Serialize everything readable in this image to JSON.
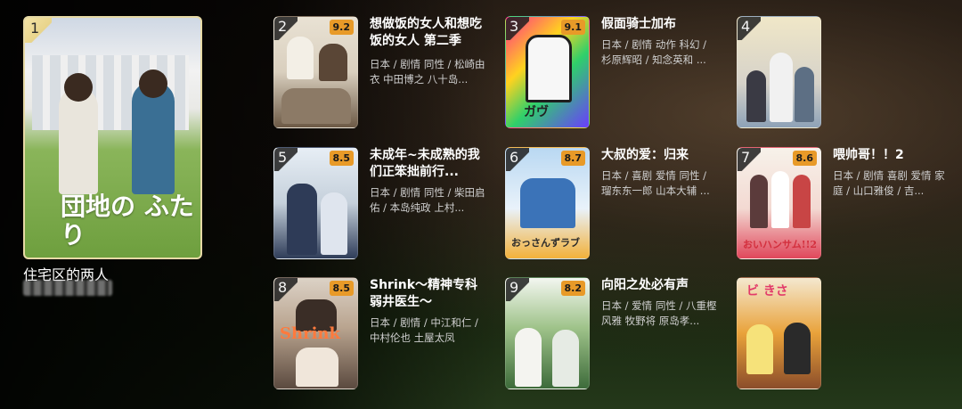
{
  "featured": {
    "rank": "1",
    "title": "住宅区的两人",
    "poster_title": "団地の ふたり"
  },
  "items": [
    {
      "rank": "2",
      "score": "9.2",
      "title": "想做饭的女人和想吃饭的女人 第二季",
      "meta": "日本 / 剧情 同性 / 松崎由衣 中田博之 八十岛..."
    },
    {
      "rank": "3",
      "score": "9.1",
      "title": "假面骑士加布",
      "meta": "日本 / 剧情 动作 科幻 / 杉原辉昭 / 知念英和 ..."
    },
    {
      "rank": "4",
      "score": "",
      "title": "",
      "meta": ""
    },
    {
      "rank": "5",
      "score": "8.5",
      "title": "未成年~未成熟的我们正笨拙前行...",
      "meta": "日本 / 剧情 同性 / 柴田启佑 / 本岛纯政 上村..."
    },
    {
      "rank": "6",
      "score": "8.7",
      "title": "大叔的爱：归来",
      "meta": "日本 / 喜剧 爱情 同性 / 瑠东东一郎 山本大辅 ..."
    },
    {
      "rank": "7",
      "score": "8.6",
      "title": "喂帅哥！！2",
      "meta": "日本 / 剧情 喜剧 爱情 家庭 / 山口雅俊 / 吉..."
    },
    {
      "rank": "8",
      "score": "8.5",
      "title": "Shrink～精神专科弱井医生～",
      "meta": "日本 / 剧情 / 中江和仁 / 中村伦也 土屋太凤"
    },
    {
      "rank": "9",
      "score": "8.2",
      "title": "向阳之处必有声",
      "meta": "日本 / 爱情 同性 / 八重樫风雅 牧野将 原岛孝..."
    },
    {
      "rank": "",
      "score": "",
      "title": "",
      "meta": ""
    }
  ],
  "thumb_text": {
    "t3_logo": "ガヴ",
    "t6_logo": "おっさんずラブ",
    "t7_logo": "おいハンサム!!2",
    "t8_logo": "Shrink",
    "t10_logo": "ビ きさ"
  },
  "colors": {
    "score_badge": "#e89a28",
    "featured_border": "#e6d9a5"
  }
}
